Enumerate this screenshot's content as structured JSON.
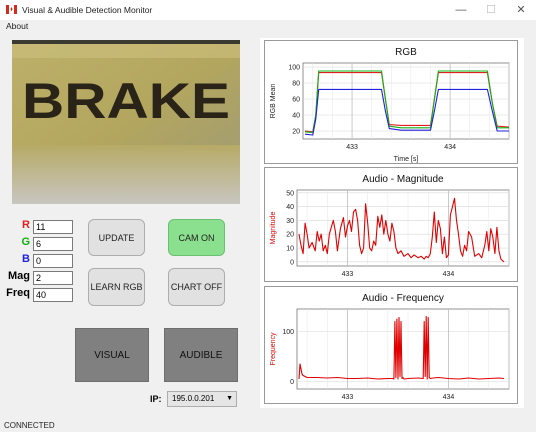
{
  "window": {
    "title": "Visual & Audible Detection Monitor",
    "controls": {
      "minimize": "—",
      "maximize": "☐",
      "close": "✕"
    }
  },
  "menu": {
    "items": [
      "About"
    ]
  },
  "camera": {
    "text": "BRAKE"
  },
  "fields": {
    "r": {
      "label": "R",
      "value": "11",
      "color": "#e02020"
    },
    "g": {
      "label": "G",
      "value": "6",
      "color": "#10b010"
    },
    "b": {
      "label": "B",
      "value": "0",
      "color": "#2020e0"
    },
    "mag": {
      "label": "Mag",
      "value": "2"
    },
    "freq": {
      "label": "Freq",
      "value": "40"
    }
  },
  "buttons": {
    "update": "UPDATE",
    "cam_on": "CAM ON",
    "learn_rgb": "LEARN RGB",
    "chart_off": "CHART OFF",
    "visual": "VISUAL",
    "audible": "AUDIBLE"
  },
  "ip": {
    "label": "IP:",
    "value": "195.0.0.201"
  },
  "status": "CONNECTED",
  "colors": {
    "audio_line": "#e00000",
    "cam_on_bg": "#8ae08e"
  },
  "chart_data": [
    {
      "type": "line",
      "title": "RGB",
      "xlabel": "Time [s]",
      "ylabel": "RGB Mean",
      "xlim": [
        432.5,
        434.6
      ],
      "ylim": [
        10,
        105
      ],
      "yticks": [
        20,
        40,
        60,
        80,
        100
      ],
      "xticks": [
        433,
        434
      ],
      "grid": true,
      "series": [
        {
          "color": "#e02020",
          "x": [
            432.52,
            432.6,
            432.63,
            432.66,
            433.0,
            433.2,
            433.3,
            433.34,
            433.38,
            433.5,
            433.7,
            433.8,
            433.84,
            433.88,
            434.0,
            434.3,
            434.38,
            434.43,
            434.48,
            434.6
          ],
          "y": [
            20,
            19,
            40,
            93,
            93,
            93,
            93,
            60,
            28,
            27,
            27,
            27,
            60,
            93,
            93,
            93,
            93,
            55,
            26,
            25
          ]
        },
        {
          "color": "#10b010",
          "x": [
            432.52,
            432.6,
            432.63,
            432.66,
            433.0,
            433.2,
            433.3,
            433.34,
            433.38,
            433.5,
            433.7,
            433.8,
            433.84,
            433.88,
            434.0,
            434.3,
            434.38,
            434.43,
            434.48,
            434.6
          ],
          "y": [
            19,
            18,
            40,
            95,
            95,
            95,
            95,
            60,
            26,
            24,
            24,
            24,
            60,
            95,
            95,
            95,
            95,
            55,
            24,
            24
          ]
        },
        {
          "color": "#2020e0",
          "x": [
            432.52,
            432.6,
            432.63,
            432.66,
            433.0,
            433.2,
            433.3,
            433.34,
            433.38,
            433.5,
            433.7,
            433.8,
            433.84,
            433.88,
            434.0,
            434.3,
            434.38,
            434.43,
            434.48,
            434.6
          ],
          "y": [
            16,
            15,
            35,
            72,
            72,
            72,
            72,
            45,
            23,
            21,
            21,
            21,
            45,
            72,
            72,
            72,
            72,
            45,
            20,
            20
          ]
        }
      ]
    },
    {
      "type": "line",
      "title": "Audio - Magnitude",
      "ylabel": "Magnitude",
      "xlim": [
        432.5,
        434.6
      ],
      "ylim": [
        -3,
        52
      ],
      "yticks": [
        0,
        10,
        20,
        30,
        40,
        50
      ],
      "xticks": [
        433,
        434
      ],
      "grid": true,
      "series": [
        {
          "color": "#e00000",
          "x": [
            432.52,
            432.54,
            432.56,
            432.58,
            432.6,
            432.62,
            432.65,
            432.68,
            432.7,
            432.72,
            432.74,
            432.76,
            432.78,
            432.8,
            432.82,
            432.84,
            432.86,
            432.88,
            432.9,
            432.93,
            432.96,
            432.98,
            433.0,
            433.02,
            433.04,
            433.06,
            433.08,
            433.1,
            433.12,
            433.14,
            433.16,
            433.18,
            433.2,
            433.22,
            433.24,
            433.26,
            433.28,
            433.3,
            433.32,
            433.34,
            433.36,
            433.38,
            433.4,
            433.42,
            433.44,
            433.46,
            433.48,
            433.5,
            433.53,
            433.56,
            433.6,
            433.63,
            433.66,
            433.7,
            433.73,
            433.76,
            433.78,
            433.8,
            433.82,
            433.84,
            433.86,
            433.88,
            433.9,
            433.92,
            433.94,
            433.96,
            433.98,
            434.0,
            434.02,
            434.04,
            434.06,
            434.08,
            434.1,
            434.12,
            434.14,
            434.16,
            434.18,
            434.2,
            434.23,
            434.26,
            434.3,
            434.33,
            434.36,
            434.38,
            434.4,
            434.42,
            434.44,
            434.46,
            434.48,
            434.5,
            434.52,
            434.55
          ],
          "y": [
            20,
            12,
            6,
            28,
            20,
            10,
            14,
            8,
            22,
            15,
            20,
            8,
            12,
            6,
            20,
            25,
            30,
            22,
            8,
            24,
            32,
            18,
            26,
            30,
            22,
            36,
            38,
            30,
            12,
            6,
            10,
            42,
            28,
            10,
            8,
            15,
            12,
            33,
            25,
            34,
            20,
            30,
            20,
            15,
            28,
            22,
            10,
            6,
            8,
            4,
            6,
            3,
            5,
            3,
            4,
            2,
            4,
            3,
            6,
            18,
            36,
            14,
            30,
            24,
            6,
            18,
            3,
            5,
            34,
            40,
            46,
            30,
            20,
            8,
            4,
            12,
            8,
            22,
            18,
            4,
            6,
            3,
            12,
            22,
            8,
            24,
            18,
            6,
            25,
            8,
            2,
            0
          ]
        }
      ]
    },
    {
      "type": "line",
      "title": "Audio - Frequency",
      "ylabel": "Frequency",
      "xlim": [
        432.5,
        434.6
      ],
      "ylim": [
        -15,
        145
      ],
      "yticks": [
        0,
        100
      ],
      "xticks": [
        433,
        434
      ],
      "grid": true,
      "series": [
        {
          "color": "#e00000",
          "x": [
            432.52,
            432.53,
            432.55,
            432.56,
            432.6,
            432.7,
            432.8,
            432.9,
            433.0,
            433.1,
            433.2,
            433.3,
            433.4,
            433.45,
            433.46,
            433.47,
            433.48,
            433.49,
            433.5,
            433.51,
            433.52,
            433.53,
            433.54,
            433.55,
            433.56,
            433.6,
            433.7,
            433.75,
            433.76,
            433.77,
            433.78,
            433.79,
            433.8,
            433.81,
            433.82,
            433.85,
            433.9,
            434.0,
            434.1,
            434.2,
            434.3,
            434.4,
            434.5,
            434.55
          ],
          "y": [
            5,
            35,
            15,
            12,
            8,
            8,
            7,
            8,
            6,
            6,
            7,
            5,
            6,
            6,
            5,
            120,
            8,
            125,
            5,
            128,
            10,
            120,
            6,
            8,
            5,
            6,
            7,
            6,
            120,
            10,
            130,
            5,
            128,
            8,
            6,
            7,
            8,
            6,
            5,
            7,
            5,
            6,
            7,
            6
          ]
        }
      ]
    }
  ]
}
